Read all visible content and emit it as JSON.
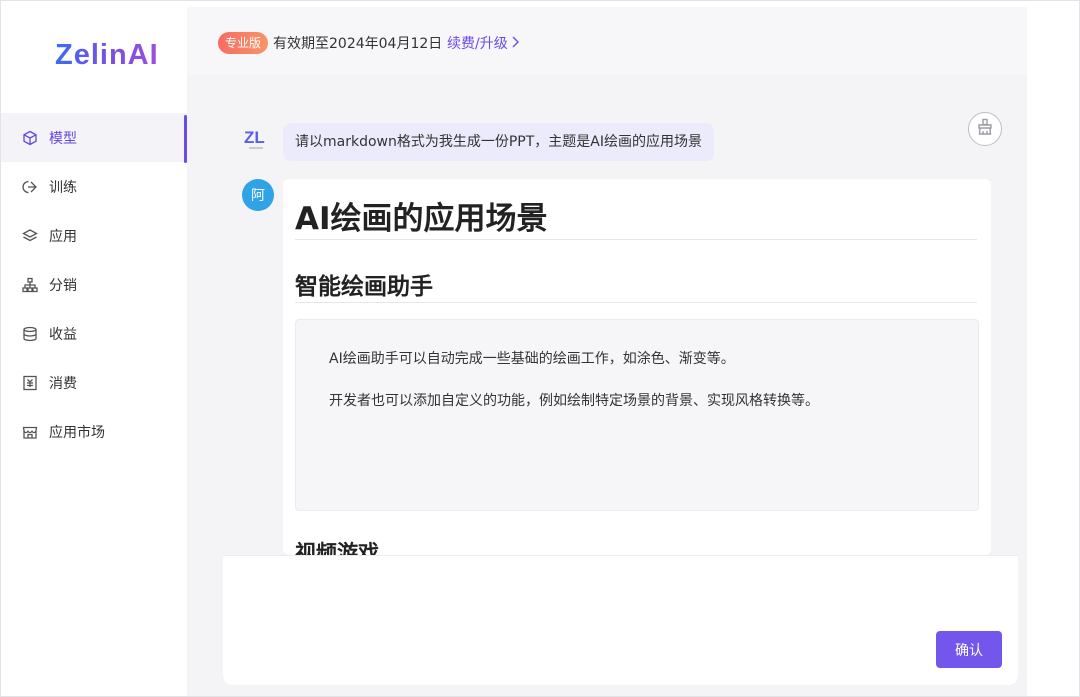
{
  "brand": {
    "logo_text": "ZelinAI"
  },
  "sidebar": {
    "items": [
      {
        "label": "模型",
        "icon": "cube-icon",
        "active": true
      },
      {
        "label": "训练",
        "icon": "training-icon",
        "active": false
      },
      {
        "label": "应用",
        "icon": "layers-icon",
        "active": false
      },
      {
        "label": "分销",
        "icon": "org-chart-icon",
        "active": false
      },
      {
        "label": "收益",
        "icon": "database-icon",
        "active": false
      },
      {
        "label": "消费",
        "icon": "receipt-icon",
        "active": false
      },
      {
        "label": "应用市场",
        "icon": "store-icon",
        "active": false
      }
    ]
  },
  "topbar": {
    "badge": "专业版",
    "validity": "有效期至2024年04月12日",
    "renew_link": "续费/升级"
  },
  "chat": {
    "user_avatar_text": "ZL",
    "user_message": "请以markdown格式为我生成一份PPT，主题是AI绘画的应用场景",
    "assistant_avatar_text": "阿",
    "answer": {
      "h1": "AI绘画的应用场景",
      "h2": "智能绘画助手",
      "paragraphs": [
        "AI绘画助手可以自动完成一些基础的绘画工作，如涂色、渐变等。",
        "开发者也可以添加自定义的功能，例如绘制特定场景的背景、实现风格转换等。"
      ],
      "next_heading": "视频游戏"
    }
  },
  "composer": {
    "confirm_label": "确认"
  },
  "colors": {
    "accent": "#6b4de6",
    "badge": "#f66d62",
    "assistant_avatar": "#2fa3e6"
  }
}
